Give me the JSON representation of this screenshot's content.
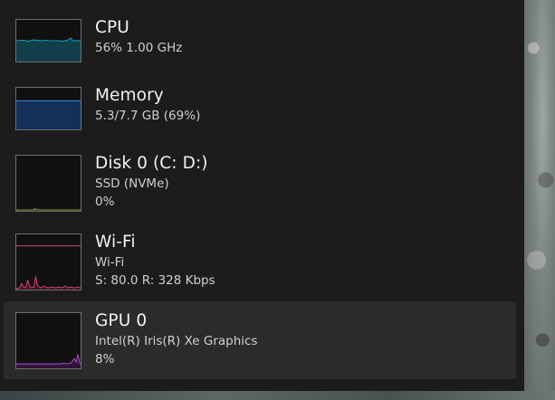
{
  "performance_list": {
    "items": [
      {
        "id": "cpu",
        "title": "CPU",
        "line1": "56%  1.00 GHz",
        "line2": "",
        "utilization_fraction": 0.56,
        "stroke_color": "#17a5c4",
        "fill_color": "#123d4a",
        "selected": false
      },
      {
        "id": "memory",
        "title": "Memory",
        "line1": "5.3/7.7 GB (69%)",
        "line2": "",
        "utilization_fraction": 0.69,
        "stroke_color": "#3a8fdf",
        "fill_color": "#14305a",
        "selected": false
      },
      {
        "id": "disk0",
        "title": "Disk 0 (C: D:)",
        "line1": "SSD (NVMe)",
        "line2": "0%",
        "utilization_fraction": 0.0,
        "stroke_color": "#8fa33a",
        "fill_color": "#2a3012",
        "selected": false
      },
      {
        "id": "wifi",
        "title": "Wi-Fi",
        "line1": "Wi-Fi",
        "line2": "S: 80.0  R: 328 Kbps",
        "utilization_fraction": 0.05,
        "stroke_color": "#d8466f",
        "fill_color": "#3a1422",
        "selected": false
      },
      {
        "id": "gpu0",
        "title": "GPU 0",
        "line1": "Intel(R) Iris(R) Xe Graphics",
        "line2": "8%",
        "utilization_fraction": 0.08,
        "stroke_color": "#b04fd1",
        "fill_color": "#2e1238",
        "selected": true
      }
    ]
  }
}
